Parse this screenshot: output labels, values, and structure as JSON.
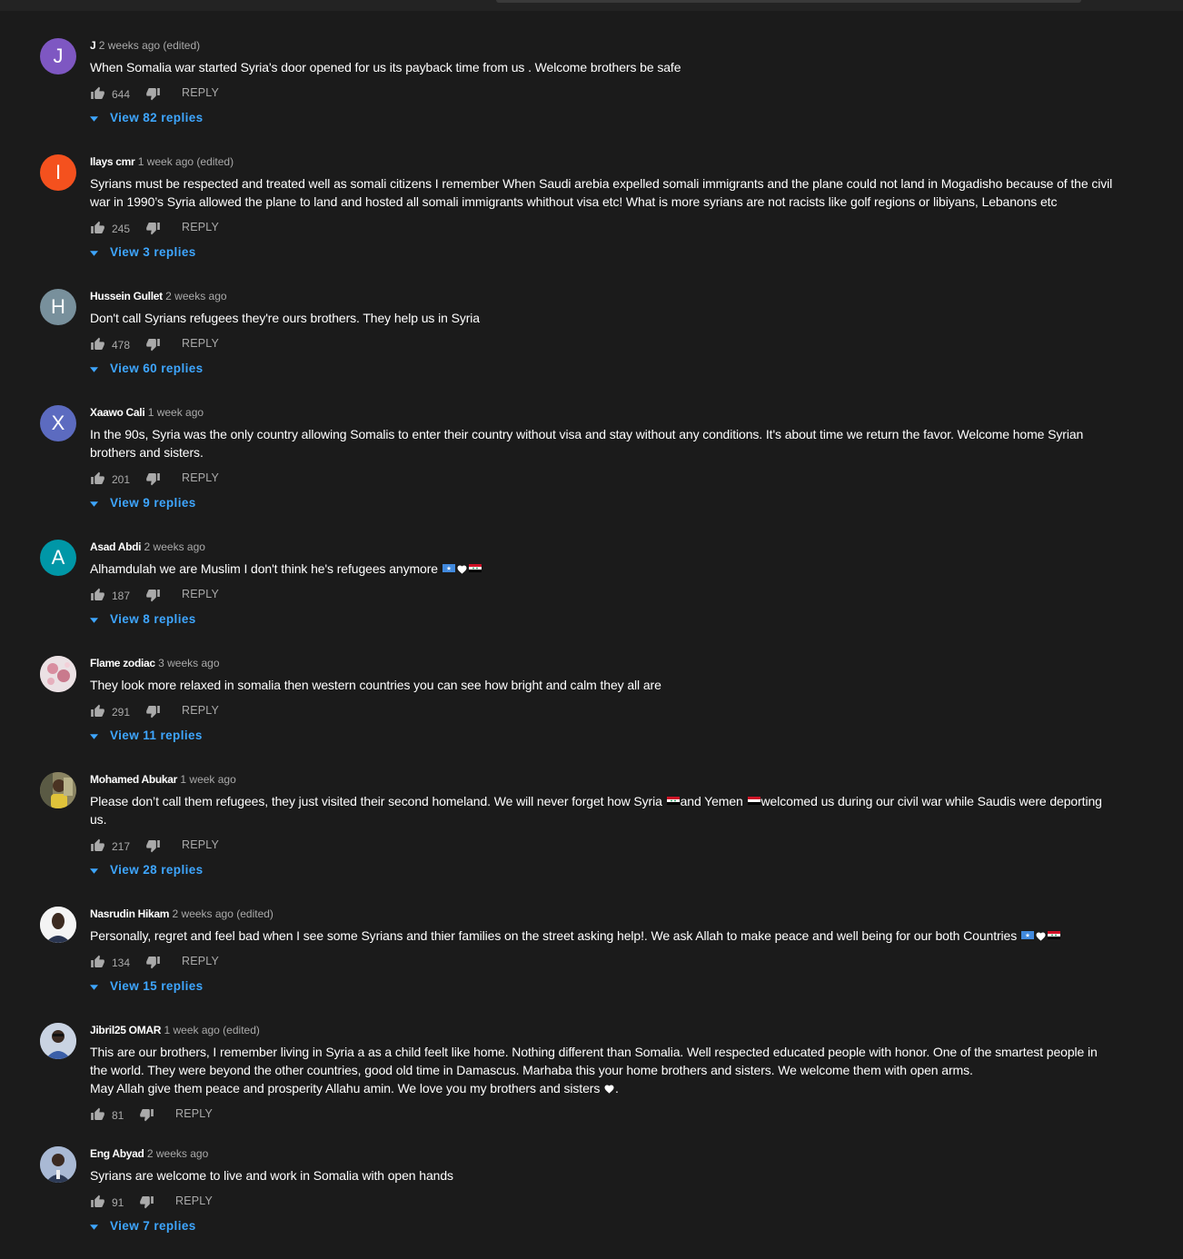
{
  "reply_label": "REPLY",
  "colors": {
    "background": "#1b1b1b",
    "link": "#3ea6ff",
    "secondary_text": "#aaaaaa"
  },
  "comments": [
    {
      "author": "J",
      "time": "2 weeks ago (edited)",
      "avatar": {
        "letter": "J",
        "color": "#7e57c2"
      },
      "text_lines": [
        "When Somalia war started Syria's door opened for us its payback time from us . Welcome brothers be safe"
      ],
      "likes": "644",
      "replies_label": "View 82 replies"
    },
    {
      "author": "Ilays cmr",
      "time": "1 week ago (edited)",
      "avatar": {
        "letter": "I",
        "color": "#f4511e"
      },
      "text_lines": [
        "Syrians must be respected and treated well as somali citizens I remember When Saudi arebia expelled somali immigrants and the plane could not land in Mogadisho because of the civil",
        "war in 1990’s  Syria allowed the plane to land and hosted all somali immigrants whithout visa etc! What is more syrians are not racists like golf regions or libiyans, Lebanons etc"
      ],
      "likes": "245",
      "replies_label": "View 3 replies"
    },
    {
      "author": "Hussein Gullet",
      "time": "2 weeks ago",
      "avatar": {
        "letter": "H",
        "color": "#78909c"
      },
      "text_lines": [
        "Don't call Syrians refugees they're ours brothers. They help us in Syria"
      ],
      "likes": "478",
      "replies_label": "View 60 replies"
    },
    {
      "author": "Xaawo Cali",
      "time": "1 week ago",
      "avatar": {
        "letter": "X",
        "color": "#5c6bc0"
      },
      "text_lines": [
        "In the 90s,  Syria was the only country allowing Somalis to enter their country without visa and stay without any conditions. It's about time we return the favor. Welcome home Syrian",
        "brothers and sisters."
      ],
      "likes": "201",
      "replies_label": "View 9 replies"
    },
    {
      "author": "Asad Abdi",
      "time": "2 weeks ago",
      "avatar": {
        "letter": "A",
        "color": "#0097a7"
      },
      "text_lines": [
        "Alhamdulah we are Muslim I don't think he's refugees anymore"
      ],
      "likes": "187",
      "replies_label": "View 8 replies"
    },
    {
      "author": "Flame zodiac",
      "time": "3 weeks ago",
      "avatar": {
        "letter": "",
        "color": "#e8d8dc"
      },
      "text_lines": [
        "They look more relaxed in somalia then western countries you can see how bright and calm they all are"
      ],
      "likes": "291",
      "replies_label": "View 11 replies"
    },
    {
      "author": "Mohamed Abukar",
      "time": "1 week ago",
      "avatar": {
        "letter": "",
        "color": "#6d6a4a"
      },
      "text_lines": [
        "Please don’t call them refugees, they just visited their second homeland. We will never forget how Syria",
        "us."
      ],
      "text_inline": [
        "and Yemen",
        "welcomed us during our civil war while Saudis were deporting"
      ],
      "likes": "217",
      "replies_label": "View 28 replies"
    },
    {
      "author": "Nasrudin Hikam",
      "time": "2 weeks ago (edited)",
      "avatar": {
        "letter": "",
        "color": "#f5f5f5"
      },
      "text_lines": [
        "Personally, regret and feel bad when I see some Syrians and thier families on the street asking help!. We ask Allah to make peace and well being for our both Countries"
      ],
      "likes": "134",
      "replies_label": "View 15 replies"
    },
    {
      "author": "Jibril25 OMAR",
      "time": "1 week ago (edited)",
      "avatar": {
        "letter": "",
        "color": "#9fb0c8"
      },
      "text_lines": [
        "This are our brothers, I remember  living in Syria a as a child feelt like home. Nothing different than Somalia. Well respected  educated  people  with honor. One of the smartest people in",
        "the world. They were beyond the other  countries, good old time in Damascus. Marhaba this your home brothers and sisters.  We welcome  them with open arms.",
        "May Allah  give them peace  and prosperity Allahu amin. We love you my brothers and sisters"
      ],
      "likes": "81",
      "replies_label": ""
    },
    {
      "author": "Eng Abyad",
      "time": "2 weeks ago",
      "avatar": {
        "letter": "",
        "color": "#8fa3c4"
      },
      "text_lines": [
        "Syrians are welcome to live and work in Somalia with open hands"
      ],
      "likes": "91",
      "replies_label": "View 7 replies"
    }
  ]
}
